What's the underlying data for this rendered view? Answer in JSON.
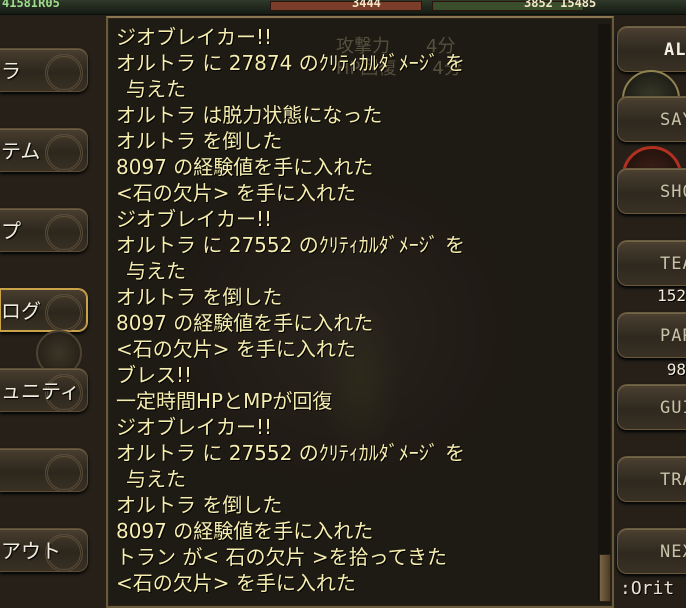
{
  "topbar": {
    "left_value": "4158IR05",
    "mid_value": "3444",
    "right_value": "3852 15485"
  },
  "left_menu": {
    "items": [
      {
        "label": "ラ"
      },
      {
        "label": "テム"
      },
      {
        "label": "プ"
      },
      {
        "label": "ログ"
      },
      {
        "label": "ュニティ"
      },
      {
        "label": ""
      },
      {
        "label": "アウト"
      }
    ]
  },
  "background_panel": {
    "line1": "攻撃力　　4分",
    "line2": "HP回復　　4分"
  },
  "log": {
    "lines": [
      "ジオブレイカー!!",
      "オルトラ に 27874 のｸﾘﾃｨｶﾙﾀﾞﾒｰｼﾞ を",
      "与えた",
      "オルトラ は脱力状態になった",
      "オルトラ を倒した",
      "8097 の経験値を手に入れた",
      "<石の欠片> を手に入れた",
      "ジオブレイカー!!",
      "オルトラ に 27552 のｸﾘﾃｨｶﾙﾀﾞﾒｰｼﾞ を",
      "与えた",
      "オルトラ を倒した",
      "8097 の経験値を手に入れた",
      "<石の欠片> を手に入れた",
      "ブレス!!",
      "一定時間HPとMPが回復",
      "ジオブレイカー!!",
      "オルトラ に 27552 のｸﾘﾃｨｶﾙﾀﾞﾒｰｼﾞ を",
      "与えた",
      "オルトラ を倒した",
      "8097 の経験値を手に入れた",
      "トラン が< 石の欠片 >を拾ってきた",
      "<石の欠片> を手に入れた"
    ]
  },
  "right_menu": {
    "buttons": [
      {
        "label": "ALL"
      },
      {
        "label": "SAY"
      },
      {
        "label": "SHOUT"
      },
      {
        "label": "TEAM"
      },
      {
        "label": "PARTY"
      },
      {
        "label": "GUILD"
      },
      {
        "label": "TRADE"
      },
      {
        "label": "NEXT"
      }
    ],
    "num1": "152",
    "num2": "98",
    "bottom_tag": ":Orit"
  },
  "colors": {
    "log_text": "#f6eeb0",
    "panel_border": "#6a5a3c",
    "menu_text": "#f0ecdc"
  }
}
